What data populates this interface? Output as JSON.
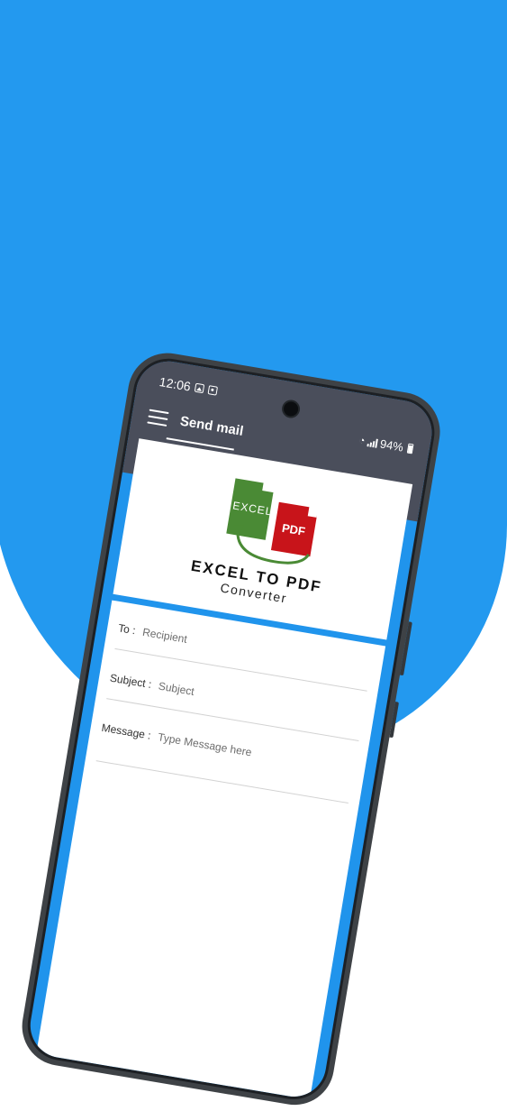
{
  "status_bar": {
    "time": "12:06",
    "battery": "94%"
  },
  "app_bar": {
    "title": "Send mail",
    "menu_icon": "hamburger-menu-icon"
  },
  "logo": {
    "excel_label": "EXCEL",
    "pdf_label": "PDF",
    "title": "EXCEL TO PDF",
    "subtitle": "Converter"
  },
  "form": {
    "to_label": "To :",
    "to_placeholder": "Recipient",
    "subject_label": "Subject :",
    "subject_placeholder": "Subject",
    "message_label": "Message :",
    "message_placeholder": "Type Message here"
  },
  "colors": {
    "background_blue": "#2399ef",
    "app_bar": "#4a4e5b",
    "excel_green": "#4a8a35",
    "pdf_red": "#c8141a"
  }
}
